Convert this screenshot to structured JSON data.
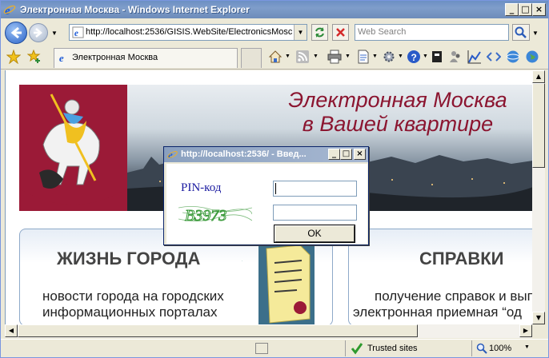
{
  "window": {
    "title": "Электронная Москва - Windows Internet Explorer",
    "minimize": "_",
    "maximize": "□",
    "close": "×"
  },
  "navbar": {
    "address": "http://localhost:2536/GISIS.WebSite/ElectronicsMosco",
    "search_placeholder": "Web Search",
    "back_icon": "back-arrow-icon",
    "forward_icon": "forward-arrow-icon"
  },
  "tab": {
    "label": "Электронная Москва"
  },
  "banner": {
    "line1": "Электронная Москва",
    "line2": "в Вашей квартире"
  },
  "panels": [
    {
      "title": "ЖИЗНЬ ГОРОДА",
      "text_line1": "новости города на городских",
      "text_line2": "информационных порталах"
    },
    {
      "title": "СПРАВКИ",
      "text_line1": "получение справок и вып",
      "text_line2": "электронная приемная “од"
    }
  ],
  "dialog": {
    "title": "http://localhost:2536/ - Введ...",
    "pin_label": "PIN-код",
    "pin_value": "",
    "captcha_value": "",
    "captcha_text": "B3973",
    "ok_label": "OK"
  },
  "status": {
    "zone": "Trusted sites",
    "zoom": "100%"
  },
  "colors": {
    "title_bar": "#7f9dca",
    "brand": "#8b1530",
    "crest": "#9b1a37"
  }
}
